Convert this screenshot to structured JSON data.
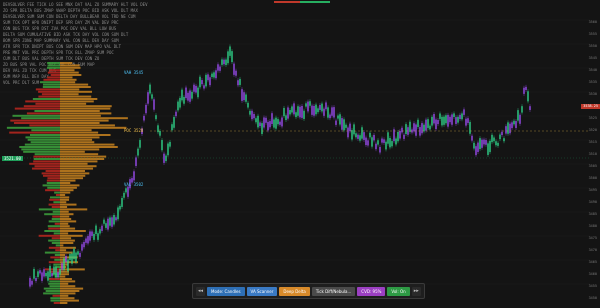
{
  "info_lines": [
    "DEVSOLVER  FEE  TICK  LO  SEE  MNX  DAT  VAL  ZO  SUMMARY  HLT  VOL  DEV",
    "ZO  SPR  DELTA  BUS  ZMAP  VWAP  DEPTH  POC  BID  ASK  VOL  DLT  MAX",
    "DEVSOLVER  SUM  SUM  CON  DELTA  DAY  BULLBEAR  VOL  TRD  NE  CUM",
    "SUM  TCK  OPT  HPO  DNIPT  DEP  SPR  DAY  ZM  VAL  DEV  PRC",
    "CON  BUS  TCK  SPR  DST  ZVA  POC  DEV  VAL  BLL  LOW  BUS",
    "DELTA  SUM  CUMULATIVE  BID  ASK  TCK  DAY  VOL  CON  SUM  DLT",
    "BOM  SPR  ZONE  MAP  SUMMARY  VAL  CON  BLL  DEV  DAY  SUM",
    "ATR  SPR  TCK  DNIPT  BUS  CON  SUM  DEV  MAP  HPO  VAL  DLT",
    "PRE  MKT  VOL  PRC  DEPTH  SPR  TCK  BLL  ZMAP  SUM  POC",
    "CUM  DLT  BUS  VAL  DEPTH  SUM  TCK  DEV  CON  ZO",
    "ZO  BUS  SPR  VAL  POC  DAY  VOL  CON  SUM  MAP",
    "DEV  VAL  ZO  TCK  CUM  BUS",
    "SUM  MAP  BLL  DEV  DAY",
    "VOL  PRC  DLT  SUM"
  ],
  "markers": {
    "upper_label": "VAH 3545",
    "poc_label": "POC 3528",
    "lower_label": "VAL 3502",
    "left_price_tag": "3521.00"
  },
  "right_axis": {
    "labels": [
      "3560",
      "3555",
      "3550",
      "3545",
      "3540",
      "3535",
      "3530",
      "3525",
      "3520",
      "3515",
      "3510",
      "3505",
      "3500",
      "3495",
      "3490",
      "3485",
      "3480",
      "3475",
      "3470",
      "3465",
      "3460",
      "3455",
      "3450"
    ],
    "current_price": "3538.25"
  },
  "toolbar": {
    "prev_label": "◂◂",
    "buttons": [
      {
        "label": "Mode: Candles",
        "color": "#2e6fb5"
      },
      {
        "label": "VA Scanner",
        "color": "#3a7ac4"
      },
      {
        "label": "Deep Delta",
        "color": "#d88a2a"
      },
      {
        "label": "Tick Diff/Nebula...",
        "color": "#4a4a4a"
      },
      {
        "label": "CVD: 95%",
        "color": "#9b3fc2"
      },
      {
        "label": "Vol: On",
        "color": "#2d9a44"
      }
    ],
    "next_label": "▸▸"
  },
  "colors": {
    "bull": "#2dd48a",
    "bear": "#9a4cf0",
    "profile_red": "#b3261e",
    "profile_green": "#3a9a3a",
    "profile_orange": "#c8821f",
    "poc_line": "#f2c14e",
    "price_tag": "#1f9e5a"
  }
}
